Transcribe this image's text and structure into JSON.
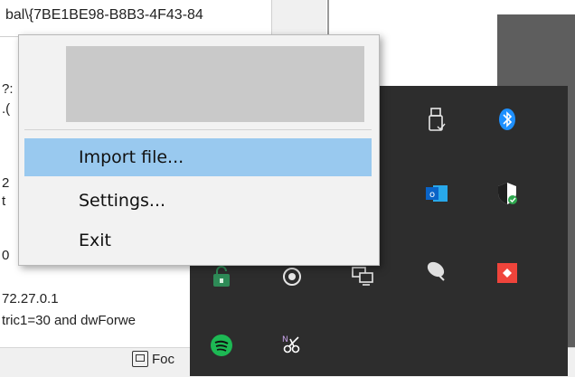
{
  "background": {
    "guid_text": "bal\\{7BE1BE98-B8B3-4F43-84",
    "left_fragments": [
      "?:",
      ".(",
      "2",
      "t",
      "0"
    ],
    "ip_text": "72.27.0.1",
    "metric_text": "tric1=30 and dwForwe",
    "focus_label": "Foc"
  },
  "menu": {
    "items": [
      {
        "label": "Import file...",
        "highlighted": true
      },
      {
        "label": "Settings...",
        "highlighted": false
      },
      {
        "label": "Exit",
        "highlighted": false
      }
    ]
  },
  "tray": {
    "icons": [
      {
        "name": "usb-drive-icon"
      },
      {
        "name": "bluetooth-icon",
        "color": "#1e90ff"
      },
      {
        "name": "outlook-icon",
        "color": "#0a64c8"
      },
      {
        "name": "security-shield-icon",
        "color": "#2fa84f"
      },
      {
        "name": "network-icon"
      },
      {
        "name": "satellite-dish-icon"
      },
      {
        "name": "anydesk-icon",
        "color": "#ef443b"
      },
      {
        "name": "camera-lens-icon"
      },
      {
        "name": "vpn-lock-icon",
        "color": "#2e8b57"
      },
      {
        "name": "spotify-icon",
        "color": "#1db954"
      },
      {
        "name": "onenote-clip-icon",
        "color": "#a566d6"
      }
    ]
  },
  "colors": {
    "menu_highlight": "#99c9ef",
    "tray_background": "#2d2d2d"
  }
}
